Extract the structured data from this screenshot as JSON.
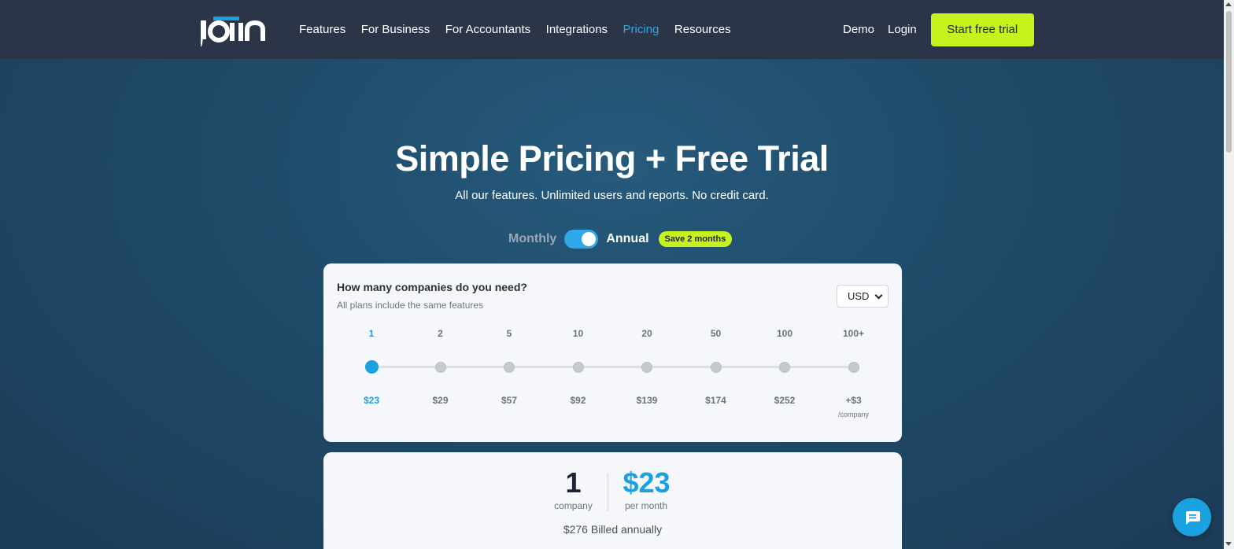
{
  "nav": {
    "logo_text": "joiin",
    "links": [
      {
        "label": "Features",
        "active": false
      },
      {
        "label": "For Business",
        "active": false
      },
      {
        "label": "For Accountants",
        "active": false
      },
      {
        "label": "Integrations",
        "active": false
      },
      {
        "label": "Pricing",
        "active": true
      },
      {
        "label": "Resources",
        "active": false
      }
    ],
    "demo": "Demo",
    "login": "Login",
    "cta": "Start free trial"
  },
  "hero": {
    "title": "Simple Pricing + Free Trial",
    "subtitle": "All our features. Unlimited users and reports. No credit card."
  },
  "billing": {
    "monthly": "Monthly",
    "annual": "Annual",
    "save_badge": "Save 2 months",
    "annual_selected": true
  },
  "selector": {
    "question": "How many companies do you need?",
    "note": "All plans include the same features",
    "currency": "USD",
    "tiers": [
      {
        "count": "1",
        "price": "$23",
        "active": true
      },
      {
        "count": "2",
        "price": "$29",
        "active": false
      },
      {
        "count": "5",
        "price": "$57",
        "active": false
      },
      {
        "count": "10",
        "price": "$92",
        "active": false
      },
      {
        "count": "20",
        "price": "$139",
        "active": false
      },
      {
        "count": "50",
        "price": "$174",
        "active": false
      },
      {
        "count": "100",
        "price": "$252",
        "active": false
      },
      {
        "count": "100+",
        "price": "+$3",
        "per": "/company",
        "active": false
      }
    ]
  },
  "summary": {
    "count": "1",
    "count_label": "company",
    "price": "$23",
    "price_label": "per month",
    "billed": "$276 Billed annually"
  },
  "colors": {
    "accent": "#1aa1df",
    "cta": "#c8f21e",
    "nav_bg": "#2c3448"
  }
}
